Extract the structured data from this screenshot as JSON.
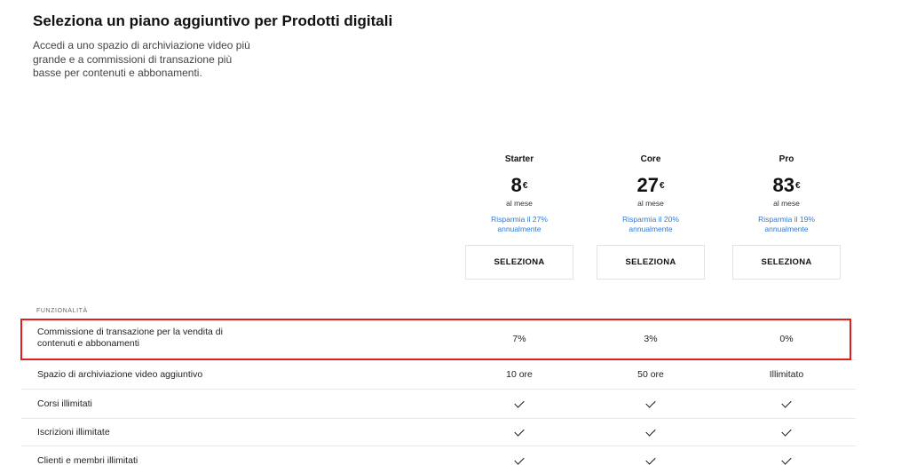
{
  "header": {
    "title": "Seleziona un piano aggiuntivo per Prodotti digitali",
    "subtitle": "Accedi a uno spazio di archiviazione video più grande e a commissioni di transazione più basse per contenuti e abbonamenti."
  },
  "plans": [
    {
      "name": "Starter",
      "price": "8",
      "currency": "€",
      "period": "al mese",
      "save_line1": "Risparmia il 27%",
      "save_line2": "annualmente",
      "button": "SELEZIONA"
    },
    {
      "name": "Core",
      "price": "27",
      "currency": "€",
      "period": "al mese",
      "save_line1": "Risparmia il 20%",
      "save_line2": "annualmente",
      "button": "SELEZIONA"
    },
    {
      "name": "Pro",
      "price": "83",
      "currency": "€",
      "period": "al mese",
      "save_line1": "Risparmia il 19%",
      "save_line2": "annualmente",
      "button": "SELEZIONA"
    }
  ],
  "features_label": "FUNZIONALITÀ",
  "features": [
    {
      "name_line1": "Commissione di transazione per la vendita di",
      "name_line2": "contenuti e abbonamenti",
      "values": [
        "7%",
        "3%",
        "0%"
      ]
    },
    {
      "name_line1": "Spazio di archiviazione video aggiuntivo",
      "name_line2": "",
      "values": [
        "10 ore",
        "50 ore",
        "Illimitato"
      ]
    },
    {
      "name_line1": "Corsi illimitati",
      "name_line2": "",
      "values": [
        "check",
        "check",
        "check"
      ]
    },
    {
      "name_line1": "Iscrizioni illimitate",
      "name_line2": "",
      "values": [
        "check",
        "check",
        "check"
      ]
    },
    {
      "name_line1": "Clienti e membri illimitati",
      "name_line2": "",
      "values": [
        "check",
        "check",
        "check"
      ]
    }
  ],
  "colors": {
    "link": "#2f7bd3",
    "highlight": "#e21d1d",
    "divider": "#e8e8e8"
  }
}
